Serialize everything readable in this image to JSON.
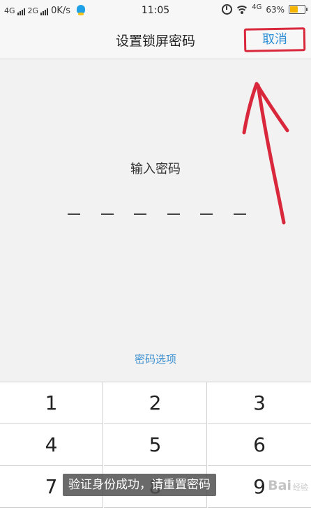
{
  "status_bar": {
    "net1": "4G",
    "net2": "2G",
    "speed": "0K/s",
    "time": "11:05",
    "net3": "4G",
    "battery": "63%",
    "battery_level": 0.63
  },
  "nav": {
    "title": "设置锁屏密码",
    "cancel": "取消"
  },
  "prompt": "输入密码",
  "password_options": "密码选项",
  "keypad": {
    "keys": [
      "1",
      "2",
      "3",
      "4",
      "5",
      "6",
      "7",
      "8",
      "9"
    ]
  },
  "toast": "验证身份成功，请重置密码",
  "watermark": {
    "brand": "Bai",
    "sub": "经验"
  }
}
